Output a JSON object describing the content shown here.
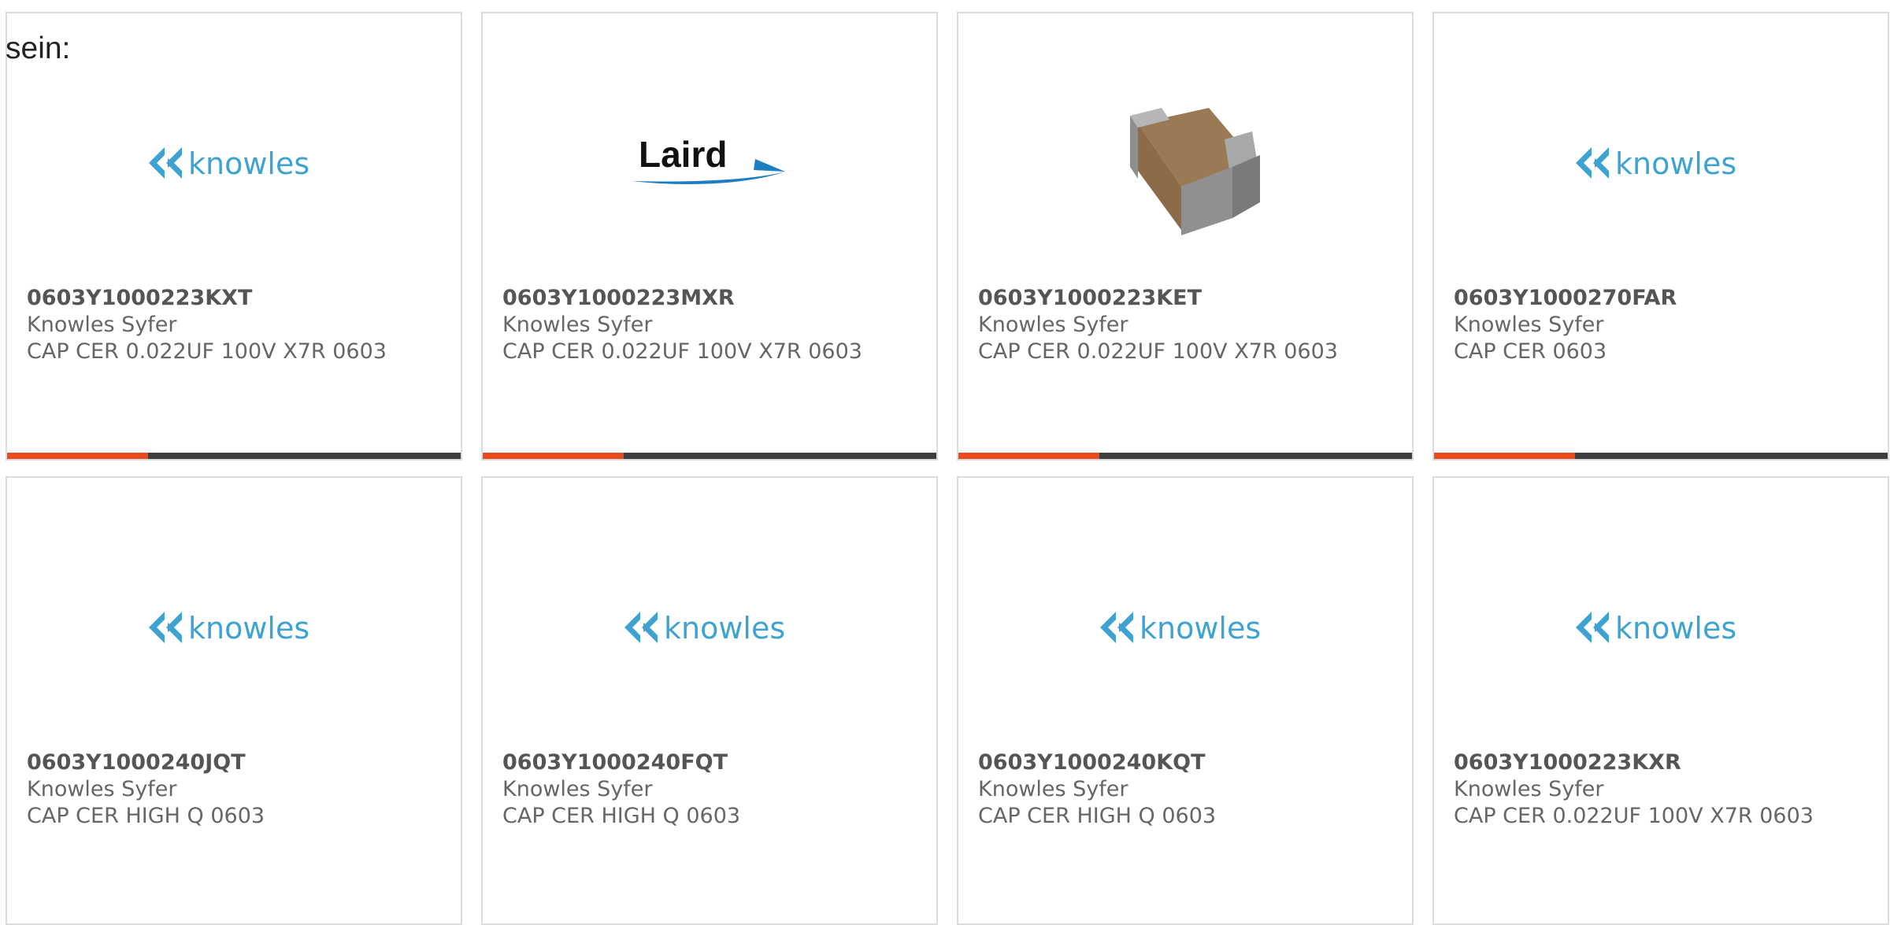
{
  "intro_text": "sein:",
  "colors": {
    "knowles_blue": "#3ea3d0",
    "laird_blue": "#1f7ec2",
    "accent_orange": "#e84c1e",
    "bar_dark": "#3f3f3f"
  },
  "cards": [
    {
      "part_number": "0603Y1000223KXT",
      "manufacturer": "Knowles Syfer",
      "description": "CAP CER 0.022UF 100V X7R 0603",
      "image": "knowles-logo",
      "logo_text": "knowles",
      "progress_fraction": 0.31
    },
    {
      "part_number": "0603Y1000223MXR",
      "manufacturer": "Knowles Syfer",
      "description": "CAP CER 0.022UF 100V X7R 0603",
      "image": "laird-logo",
      "logo_text": "Laird",
      "progress_fraction": 0.31
    },
    {
      "part_number": "0603Y1000223KET",
      "manufacturer": "Knowles Syfer",
      "description": "CAP CER 0.022UF 100V X7R 0603",
      "image": "capacitor-photo",
      "progress_fraction": 0.31
    },
    {
      "part_number": "0603Y1000270FAR",
      "manufacturer": "Knowles Syfer",
      "description": "CAP CER 0603",
      "image": "knowles-logo",
      "logo_text": "knowles",
      "progress_fraction": 0.31
    },
    {
      "part_number": "0603Y1000240JQT",
      "manufacturer": "Knowles Syfer",
      "description": "CAP CER HIGH Q 0603",
      "image": "knowles-logo",
      "logo_text": "knowles"
    },
    {
      "part_number": "0603Y1000240FQT",
      "manufacturer": "Knowles Syfer",
      "description": "CAP CER HIGH Q 0603",
      "image": "knowles-logo",
      "logo_text": "knowles"
    },
    {
      "part_number": "0603Y1000240KQT",
      "manufacturer": "Knowles Syfer",
      "description": "CAP CER HIGH Q 0603",
      "image": "knowles-logo",
      "logo_text": "knowles"
    },
    {
      "part_number": "0603Y1000223KXR",
      "manufacturer": "Knowles Syfer",
      "description": "CAP CER 0.022UF 100V X7R 0603",
      "image": "knowles-logo",
      "logo_text": "knowles"
    }
  ]
}
